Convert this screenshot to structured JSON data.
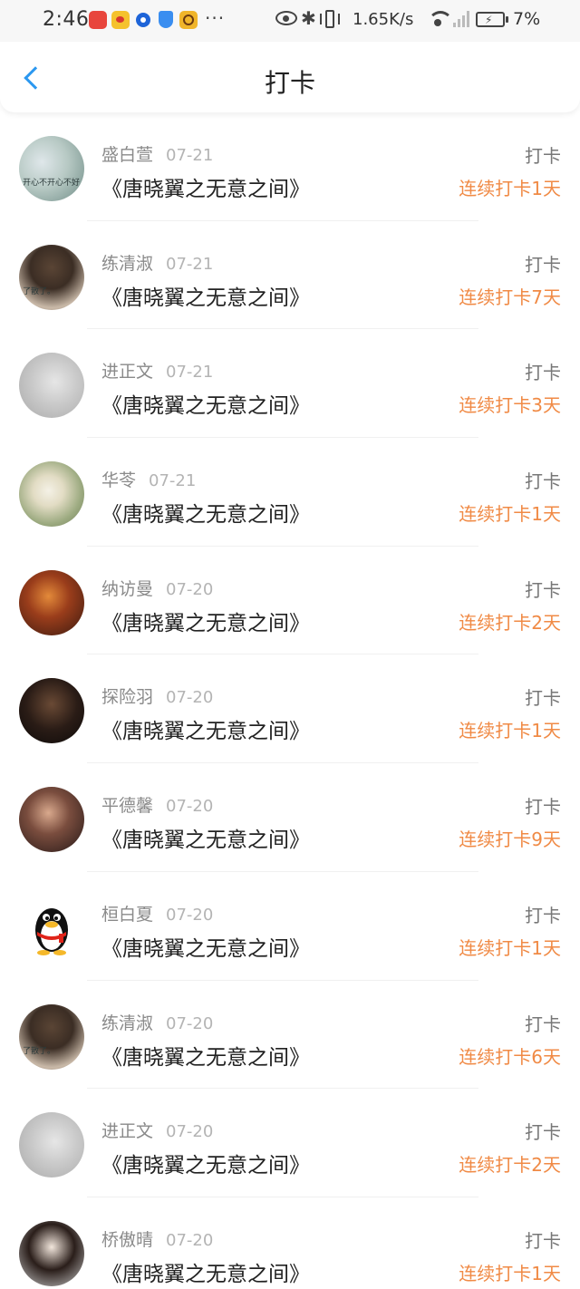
{
  "status_bar": {
    "time": "2:46",
    "more": "···",
    "bluetooth": "✱",
    "net_speed": "1.65K/s",
    "battery_charging": "⚡",
    "battery_pct": "7%"
  },
  "nav": {
    "title": "打卡",
    "back_icon": "chevron-left-icon"
  },
  "colors": {
    "accent_blue": "#2b98f0",
    "streak_orange": "#f08a45"
  },
  "items": [
    {
      "name": "盛白萱",
      "date": "07-21",
      "book": "《唐晓翼之无意之间》",
      "label": "打卡",
      "streak": "连续打卡1天",
      "avatar_text": "开心不开心不好"
    },
    {
      "name": "练清淑",
      "date": "07-21",
      "book": "《唐晓翼之无意之间》",
      "label": "打卡",
      "streak": "连续打卡7天",
      "avatar_text": "了散了。"
    },
    {
      "name": "进正文",
      "date": "07-21",
      "book": "《唐晓翼之无意之间》",
      "label": "打卡",
      "streak": "连续打卡3天",
      "avatar_text": ""
    },
    {
      "name": "华苓",
      "date": "07-21",
      "book": "《唐晓翼之无意之间》",
      "label": "打卡",
      "streak": "连续打卡1天",
      "avatar_text": ""
    },
    {
      "name": "纳访曼",
      "date": "07-20",
      "book": "《唐晓翼之无意之间》",
      "label": "打卡",
      "streak": "连续打卡2天",
      "avatar_text": ""
    },
    {
      "name": "探险羽",
      "date": "07-20",
      "book": "《唐晓翼之无意之间》",
      "label": "打卡",
      "streak": "连续打卡1天",
      "avatar_text": ""
    },
    {
      "name": "平德馨",
      "date": "07-20",
      "book": "《唐晓翼之无意之间》",
      "label": "打卡",
      "streak": "连续打卡9天",
      "avatar_text": ""
    },
    {
      "name": "桓白夏",
      "date": "07-20",
      "book": "《唐晓翼之无意之间》",
      "label": "打卡",
      "streak": "连续打卡1天",
      "avatar_text": ""
    },
    {
      "name": "练清淑",
      "date": "07-20",
      "book": "《唐晓翼之无意之间》",
      "label": "打卡",
      "streak": "连续打卡6天",
      "avatar_text": "了散了。"
    },
    {
      "name": "进正文",
      "date": "07-20",
      "book": "《唐晓翼之无意之间》",
      "label": "打卡",
      "streak": "连续打卡2天",
      "avatar_text": ""
    },
    {
      "name": "桥傲晴",
      "date": "07-20",
      "book": "《唐晓翼之无意之间》",
      "label": "打卡",
      "streak": "连续打卡1天",
      "avatar_text": ""
    }
  ]
}
